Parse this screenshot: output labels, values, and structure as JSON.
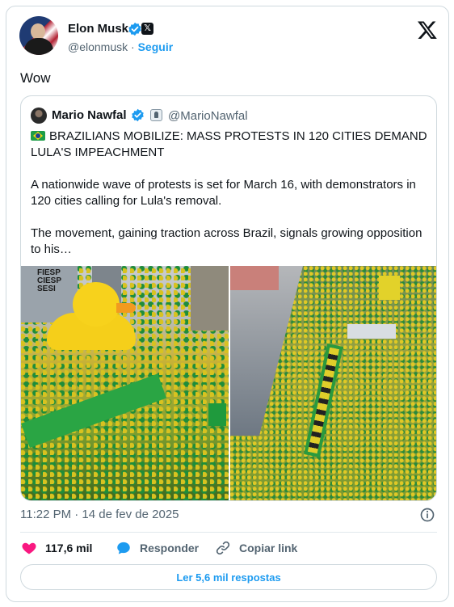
{
  "author": {
    "name": "Elon Musk",
    "handle": "@elonmusk",
    "separator": "·",
    "follow_label": "Seguir"
  },
  "tweet": {
    "text": "Wow"
  },
  "quoted": {
    "name": "Mario Nawfal",
    "handle": "@MarioNawfal",
    "headline": "BRAZILIANS MOBILIZE: MASS PROTESTS IN 120 CITIES DEMAND LULA'S IMPEACHMENT",
    "paragraph1": "A nationwide wave of protests is set for March 16, with demonstrators in 120 cities calling for Lula's removal.",
    "paragraph2": "The movement, gaining traction across Brazil, signals growing opposition to his…",
    "photo_overlay_text": "FIESP\nCIESP\nSESI"
  },
  "meta": {
    "timestamp": "11:22 PM · 14 de fev de 2025"
  },
  "actions": {
    "likes": "117,6 mil",
    "reply_label": "Responder",
    "copy_label": "Copiar link"
  },
  "read_replies_label": "Ler 5,6 mil respostas",
  "colors": {
    "accent": "#1d9bf0",
    "like": "#f91880",
    "text": "#0f1419",
    "muted": "#536471",
    "border": "#cfd9de"
  },
  "icons": {
    "verified": "verified-badge-icon",
    "x_badge": "x-affiliate-icon",
    "x_logo": "x-logo-icon",
    "info": "info-icon",
    "like": "heart-icon",
    "reply": "chat-bubble-icon",
    "copy": "link-icon"
  }
}
